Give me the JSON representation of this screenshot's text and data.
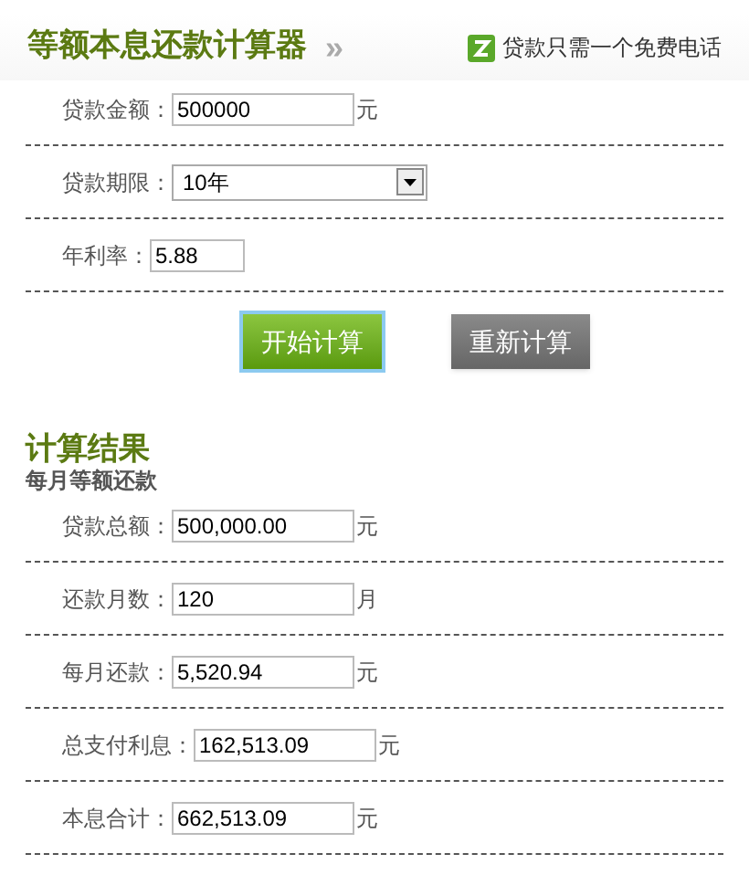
{
  "header": {
    "title": "等额本息还款计算器",
    "arrow": "»",
    "hotline": "贷款只需一个免费电话"
  },
  "inputs": [
    {
      "kind": "text",
      "label": "贷款金额：",
      "value": "500000",
      "unit": "元"
    },
    {
      "kind": "select",
      "label": "贷款期限：",
      "value": "10年"
    },
    {
      "kind": "short",
      "label": "年利率：",
      "value": "5.88"
    }
  ],
  "buttons": [
    {
      "label": "开始计算",
      "kind": "primary"
    },
    {
      "label": "重新计算",
      "kind": "secondary"
    }
  ],
  "results": {
    "title": "计算结果",
    "subtitle": "每月等额还款",
    "rows": [
      {
        "label": "贷款总额：",
        "value": "500,000.00",
        "unit": "元"
      },
      {
        "label": "还款月数：",
        "value": "120",
        "unit": "月"
      },
      {
        "label": "每月还款：",
        "value": "5,520.94",
        "unit": "元"
      },
      {
        "label": "总支付利息：",
        "value": "162,513.09",
        "unit": "元"
      },
      {
        "label": "本息合计：",
        "value": "662,513.09",
        "unit": "元"
      }
    ]
  }
}
